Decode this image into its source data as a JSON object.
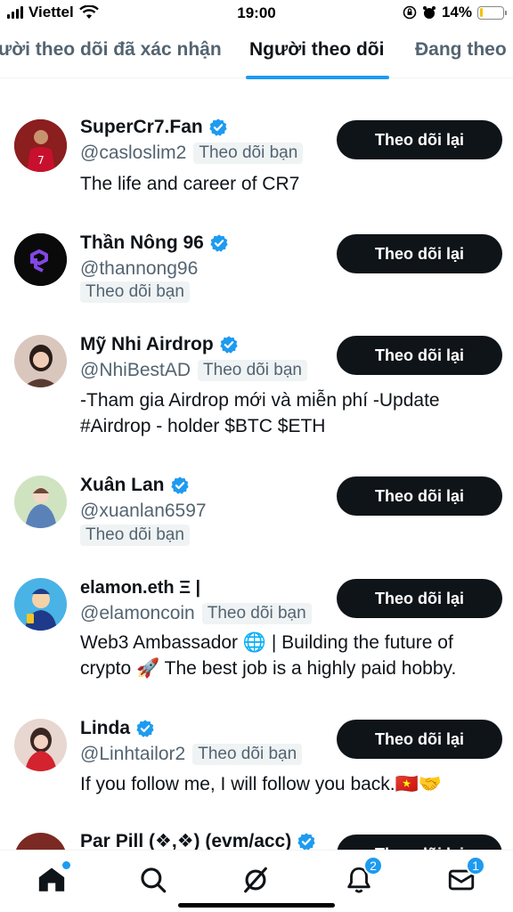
{
  "status_bar": {
    "carrier": "Viettel",
    "time": "19:00",
    "battery": "14%",
    "battery_level": 0.14
  },
  "tabs": [
    {
      "label": "ười theo dõi đã xác nhận",
      "active": false
    },
    {
      "label": "Người theo dõi",
      "active": true
    },
    {
      "label": "Đang theo",
      "active": false
    }
  ],
  "colors": {
    "accent": "#1d9bf0",
    "button": "#0f1419",
    "muted": "#536471",
    "badge_bg": "#eff3f4"
  },
  "follow_badge": "Theo dõi bạn",
  "follow_back_label": "Theo dõi lại",
  "followers": [
    {
      "name": "SuperCr7.Fan",
      "handle": "@casloslim2",
      "bio": "The life and career of CR7",
      "verified": true
    },
    {
      "name": "Thần Nông 96",
      "handle": "@thannong96",
      "bio": "",
      "verified": true
    },
    {
      "name": "Mỹ Nhi Airdrop",
      "handle": "@NhiBestAD",
      "bio": "-Tham gia Airdrop mới và miễn phí -Update #Airdrop - holder $BTC $ETH",
      "verified": true
    },
    {
      "name": "Xuân Lan",
      "handle": "@xuanlan6597",
      "bio": "",
      "verified": true
    },
    {
      "name": "elamon.eth Ξ |",
      "handle": "@elamoncoin",
      "bio": "Web3 Ambassador 🌐 | Building the future of crypto 🚀 The best job is a highly paid hobby.",
      "verified": false
    },
    {
      "name": "Linda",
      "handle": "@Linhtailor2",
      "bio": "If you follow me, I will follow you back.🇻🇳🤝",
      "verified": true
    },
    {
      "name": "Par Pill (❖,❖) (evm/acc)",
      "handle": "",
      "bio": "",
      "verified": true
    }
  ],
  "bottom_nav": {
    "items": [
      "home-icon",
      "search-icon",
      "grok-icon",
      "notifications-icon",
      "messages-icon"
    ],
    "notifications_count": "2",
    "messages_count": "1"
  }
}
